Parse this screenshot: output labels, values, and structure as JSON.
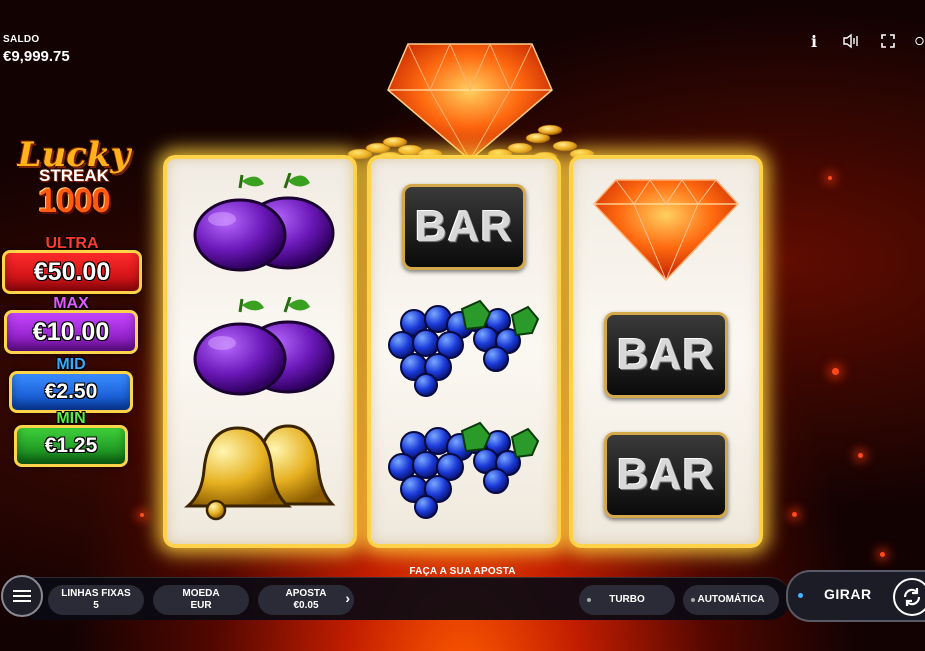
{
  "balance": {
    "label": "SALDO",
    "value": "€9,999.75"
  },
  "top_icons": [
    {
      "name": "info-icon",
      "glyph": "i"
    },
    {
      "name": "sound-icon",
      "glyph": "🔈"
    },
    {
      "name": "fullscreen-icon",
      "glyph": "⛶"
    },
    {
      "name": "history-icon",
      "glyph": "⟳"
    }
  ],
  "logo": {
    "line1": "Lucky",
    "line2": "STREAK",
    "line3": "1000"
  },
  "jackpots": [
    {
      "label": "ULTRA",
      "value": "€50.00",
      "label_color": "#ff3a2a",
      "box_color": "#d8141a"
    },
    {
      "label": "MAX",
      "value": "€10.00",
      "label_color": "#e05aff",
      "box_color": "#9a1fc8"
    },
    {
      "label": "MID",
      "value": "€2.50",
      "label_color": "#3aa8ff",
      "box_color": "#1868d8"
    },
    {
      "label": "MIN",
      "value": "€1.25",
      "label_color": "#5ae84a",
      "box_color": "#1a9a2a"
    }
  ],
  "reels": [
    [
      "plum",
      "plum",
      "bell"
    ],
    [
      "bar",
      "grapes",
      "grapes"
    ],
    [
      "diamond",
      "bar",
      "bar"
    ]
  ],
  "symbols": {
    "bar_text": "BAR"
  },
  "bottom": {
    "title": "FAÇA A SUA APOSTA",
    "lines_label": "LINHAS FIXAS",
    "lines_value": "5",
    "coin_label": "MOEDA",
    "coin_value": "EUR",
    "bet_label": "APOSTA",
    "bet_value": "€0.05",
    "bet_arrow": "›",
    "turbo_label": "TURBO",
    "auto_label": "AUTOMÁTICA",
    "spin_label": "GIRAR"
  }
}
